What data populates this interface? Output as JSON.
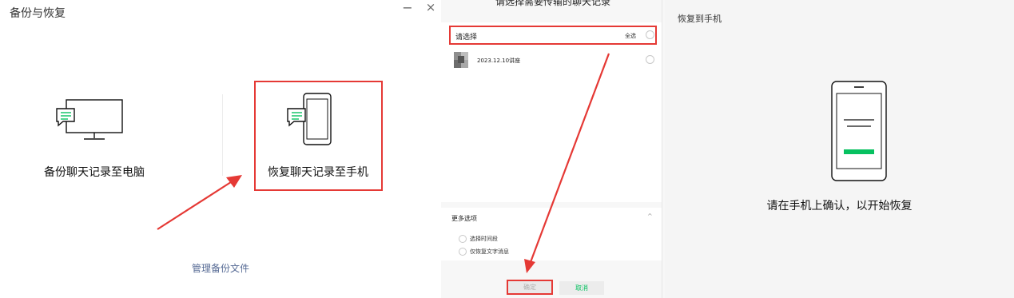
{
  "backup_window": {
    "title": "备份与恢复",
    "minimize_glyph": "−",
    "close_glyph": "×",
    "option_backup": {
      "label": "备份聊天记录至电脑",
      "icon": "monitor-chat-icon"
    },
    "option_restore": {
      "label": "恢复聊天记录至手机",
      "icon": "phone-chat-icon"
    },
    "manage_link": "管理备份文件"
  },
  "select_dialog": {
    "title": "请选择需要传输的聊天记录",
    "select_label": "请选择",
    "select_all": "全选",
    "chats": [
      {
        "name": "2023.12.10讲座"
      }
    ],
    "more_options": {
      "title": "更多选项",
      "chevron": "^",
      "options": [
        "选择时间段",
        "仅恢复文字消息"
      ]
    },
    "confirm": "确定",
    "cancel": "取消"
  },
  "restore_panel": {
    "title": "恢复到手机",
    "message": "请在手机上确认，以开始恢复"
  },
  "colors": {
    "accent_green": "#07c160",
    "highlight_red": "#e53935",
    "link_blue": "#576b95"
  }
}
